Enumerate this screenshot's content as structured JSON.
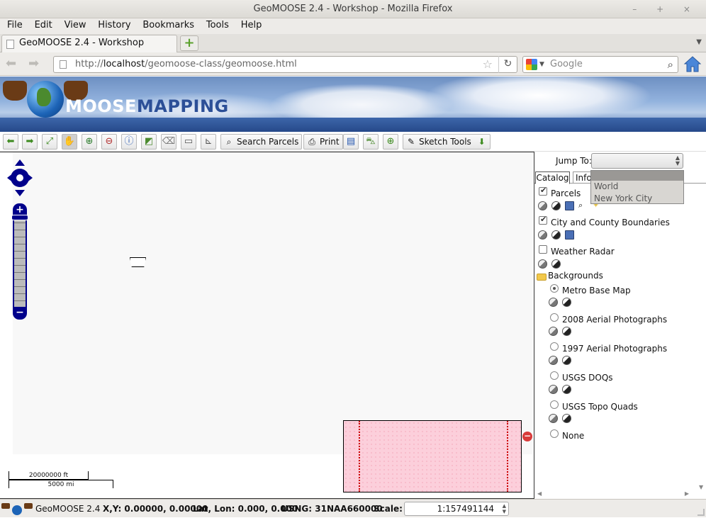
{
  "window": {
    "title": "GeoMOOSE 2.4 - Workshop - Mozilla Firefox",
    "controls": "–  +  ×"
  },
  "menu": [
    "File",
    "Edit",
    "View",
    "History",
    "Bookmarks",
    "Tools",
    "Help"
  ],
  "tabs": {
    "active_label": "GeoMOOSE 2.4 - Workshop",
    "new_tab_symbol": "+"
  },
  "nav": {
    "url_prefix": "http://",
    "url_host": "localhost",
    "url_path": "/geomoose-class/geomoose.html",
    "search_placeholder": "Google",
    "search_engine_icon": "google-icon"
  },
  "banner": {
    "logo_part1": "MOOSE",
    "logo_part2": "MAPPING"
  },
  "toolbar": {
    "search_parcels_label": "Search Parcels",
    "print_label": "Print",
    "sketch_tools_label": "Sketch Tools",
    "icons": [
      "back-arrow-icon",
      "forward-arrow-icon",
      "zoom-extent-icon",
      "pan-hand-icon",
      "zoom-in-icon",
      "zoom-out-icon",
      "identify-icon",
      "select-icon",
      "eraser-icon",
      "measure-length-icon",
      "measure-area-icon",
      "search-icon",
      "print-icon",
      "layers-export-icon",
      "car-icon",
      "gps-icon",
      "palette-icon",
      "down-arrow-icon"
    ]
  },
  "map": {
    "scalebar_top": "20000000 ft",
    "scalebar_bottom": "5000 mi"
  },
  "panel": {
    "jump_to_label": "Jump To:",
    "jump_options": [
      "World",
      "New York City"
    ],
    "tab_catalog": "Catalog",
    "tab_info": "Info",
    "layers": [
      {
        "label": "Parcels",
        "checked": true
      },
      {
        "label": "City and County Boundaries",
        "checked": true
      },
      {
        "label": "Weather Radar",
        "checked": false
      }
    ],
    "folder": "Backgrounds",
    "backgrounds": [
      {
        "label": "Metro Base Map",
        "selected": true
      },
      {
        "label": "2008 Aerial Photographs",
        "selected": false
      },
      {
        "label": "1997 Aerial Photographs",
        "selected": false
      },
      {
        "label": "USGS DOQs",
        "selected": false
      },
      {
        "label": "USGS Topo Quads",
        "selected": false
      },
      {
        "label": "None",
        "selected": false
      }
    ]
  },
  "status": {
    "app_name": "GeoMOOSE 2.4",
    "xy": "X,Y: 0.00000, 0.00000",
    "latlon": "Lat, Lon: 0.000, 0.000",
    "usng": "USNG: 31NAA660000",
    "scale_label": "Scale:",
    "scale_value": "1:157491144"
  },
  "colors": {
    "map_nav_blue": "#00008b",
    "overview_fill": "#fccfdb",
    "overview_extent": "#cc0000"
  }
}
